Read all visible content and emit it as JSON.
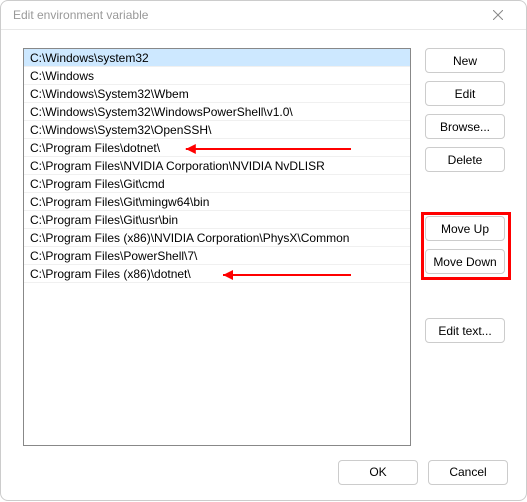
{
  "window": {
    "title": "Edit environment variable"
  },
  "list": {
    "items": [
      {
        "path": "C:\\Windows\\system32",
        "selected": true
      },
      {
        "path": "C:\\Windows",
        "selected": false
      },
      {
        "path": "C:\\Windows\\System32\\Wbem",
        "selected": false
      },
      {
        "path": "C:\\Windows\\System32\\WindowsPowerShell\\v1.0\\",
        "selected": false
      },
      {
        "path": "C:\\Windows\\System32\\OpenSSH\\",
        "selected": false
      },
      {
        "path": "C:\\Program Files\\dotnet\\",
        "selected": false
      },
      {
        "path": "C:\\Program Files\\NVIDIA Corporation\\NVIDIA NvDLISR",
        "selected": false
      },
      {
        "path": "C:\\Program Files\\Git\\cmd",
        "selected": false
      },
      {
        "path": "C:\\Program Files\\Git\\mingw64\\bin",
        "selected": false
      },
      {
        "path": "C:\\Program Files\\Git\\usr\\bin",
        "selected": false
      },
      {
        "path": "C:\\Program Files (x86)\\NVIDIA Corporation\\PhysX\\Common",
        "selected": false
      },
      {
        "path": "C:\\Program Files\\PowerShell\\7\\",
        "selected": false
      },
      {
        "path": "C:\\Program Files (x86)\\dotnet\\",
        "selected": false
      }
    ]
  },
  "buttons": {
    "new": "New",
    "edit": "Edit",
    "browse": "Browse...",
    "delete": "Delete",
    "moveUp": "Move Up",
    "moveDown": "Move Down",
    "editText": "Edit text...",
    "ok": "OK",
    "cancel": "Cancel"
  },
  "annotations": {
    "arrow_rows": [
      5,
      12
    ],
    "highlight_buttons": [
      "moveUp",
      "moveDown"
    ],
    "color": "#ff0000"
  }
}
